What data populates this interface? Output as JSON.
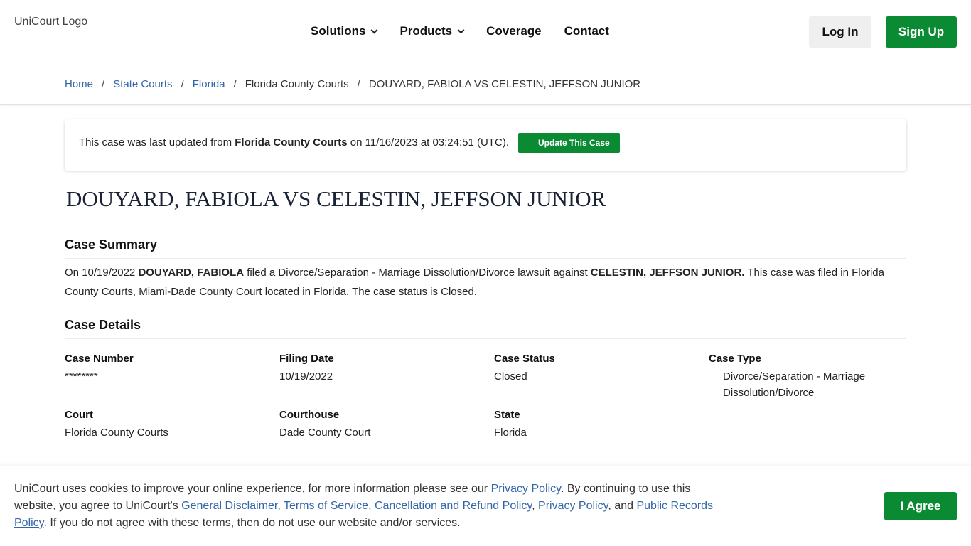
{
  "header": {
    "logo_alt": "UniCourt Logo",
    "nav": {
      "solutions": "Solutions",
      "products": "Products",
      "coverage": "Coverage",
      "contact": "Contact"
    },
    "login_label": "Log In",
    "signup_label": "Sign Up"
  },
  "breadcrumb": {
    "home": "Home",
    "state_courts": "State Courts",
    "florida": "Florida",
    "county_courts": "Florida County Courts",
    "case": "DOUYARD, FABIOLA VS CELESTIN, JEFFSON JUNIOR",
    "separator": "/"
  },
  "update": {
    "prefix": "This case was last updated from ",
    "source": "Florida County Courts",
    "on": " on ",
    "date": "11/16/2023",
    "at": " at ",
    "time": "03:24:51 (UTC).",
    "button_label": "Update This Case"
  },
  "case_title": "DOUYARD, FABIOLA VS CELESTIN, JEFFSON JUNIOR",
  "summary": {
    "heading": "Case Summary",
    "on": "On ",
    "date": "10/19/2022",
    "plaintiff": "DOUYARD, FABIOLA",
    "filed_text": " filed a Divorce/Separation - Marriage Dissolution/Divorce lawsuit against ",
    "defendant": "CELESTIN, JEFFSON JUNIOR.",
    "rest": " This case was filed in Florida County Courts, Miami-Dade County Court located in Florida. The case status is Closed."
  },
  "details": {
    "heading": "Case Details",
    "case_number_label": "Case Number",
    "case_number_value": "********",
    "filing_date_label": "Filing Date",
    "filing_date_value": "10/19/2022",
    "case_status_label": "Case Status",
    "case_status_value": "Closed",
    "case_type_label": "Case Type",
    "case_type_value": "Divorce/Separation - Marriage Dissolution/Divorce",
    "court_label": "Court",
    "court_value": "Florida County Courts",
    "courthouse_label": "Courthouse",
    "courthouse_value": "Dade County Court",
    "state_label": "State",
    "state_value": "Florida"
  },
  "cookie": {
    "text1": "UniCourt uses cookies to improve your online experience, for more information please see our ",
    "privacy_policy": "Privacy Policy",
    "text2": ". By continuing to use this website, you agree to UniCourt's ",
    "general_disclaimer": "General Disclaimer",
    "comma1": ", ",
    "terms": "Terms of Service",
    "comma2": ", ",
    "cancellation": "Cancellation and Refund Policy",
    "comma3": ", ",
    "privacy_policy2": "Privacy Policy",
    "and": ", and ",
    "public_records": "Public Records Policy",
    "text3": ". If you do not agree with these terms, then do not use our website and/or services.",
    "agree_label": "I Agree"
  },
  "colors": {
    "brand_green": "#0a8a33",
    "link_blue": "#3366a8",
    "title_navy": "#1a2236"
  }
}
